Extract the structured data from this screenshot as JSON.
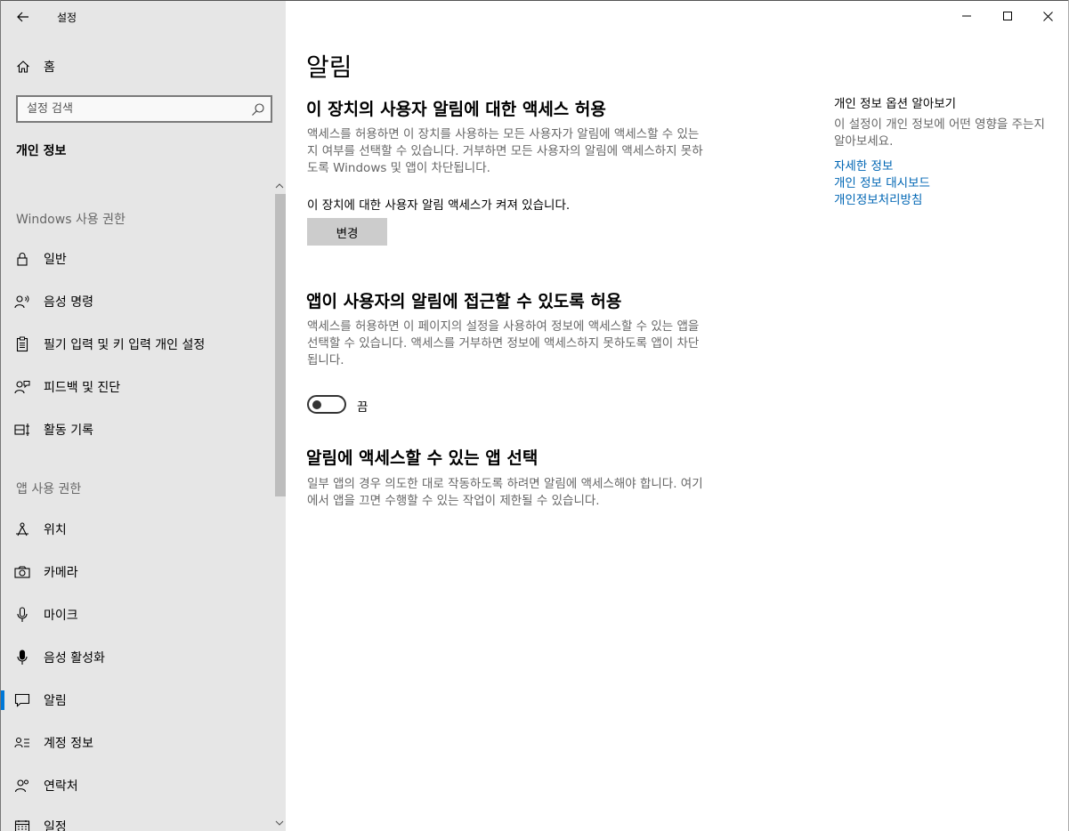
{
  "window": {
    "title": "설정",
    "controls": {
      "minimize": "minimize",
      "maximize": "maximize",
      "close": "close"
    }
  },
  "sidebar": {
    "home_label": "홈",
    "search_placeholder": "설정 검색",
    "section_title": "개인 정보",
    "groups": [
      {
        "label": "Windows 사용 권한",
        "items": [
          {
            "label": "일반",
            "icon": "lock-icon"
          },
          {
            "label": "음성 명령",
            "icon": "speech-icon"
          },
          {
            "label": "필기 입력 및 키 입력 개인 설정",
            "icon": "clipboard-icon"
          },
          {
            "label": "피드백 및 진단",
            "icon": "feedback-icon"
          },
          {
            "label": "활동 기록",
            "icon": "timeline-icon"
          }
        ]
      },
      {
        "label": "앱 사용 권한",
        "items": [
          {
            "label": "위치",
            "icon": "location-icon"
          },
          {
            "label": "카메라",
            "icon": "camera-icon"
          },
          {
            "label": "마이크",
            "icon": "microphone-icon"
          },
          {
            "label": "음성 활성화",
            "icon": "voice-activation-icon"
          },
          {
            "label": "알림",
            "icon": "notification-icon",
            "active": true
          },
          {
            "label": "계정 정보",
            "icon": "account-info-icon"
          },
          {
            "label": "연락처",
            "icon": "contacts-icon"
          },
          {
            "label": "일정",
            "icon": "calendar-icon"
          }
        ]
      }
    ]
  },
  "main": {
    "page_title": "알림",
    "section1": {
      "heading": "이 장치의 사용자 알림에 대한 액세스 허용",
      "desc": "액세스를 허용하면 이 장치를 사용하는 모든 사용자가 알림에 액세스할 수 있는지 여부를 선택할 수 있습니다. 거부하면 모든 사용자의 알림에 액세스하지 못하도록 Windows 및 앱이 차단됩니다.",
      "status": "이 장치에 대한 사용자 알림 액세스가 켜져 있습니다.",
      "button": "변경"
    },
    "section2": {
      "heading": "앱이 사용자의 알림에 접근할 수 있도록 허용",
      "desc": "액세스를 허용하면 이 페이지의 설정을 사용하여 정보에 액세스할 수 있는 앱을 선택할 수 있습니다. 액세스를 거부하면 정보에 액세스하지 못하도록 앱이 차단됩니다.",
      "toggle_state": "끔",
      "toggle_on": false
    },
    "section3": {
      "heading": "알림에 액세스할 수 있는 앱 선택",
      "desc": "일부 앱의 경우 의도한 대로 작동하도록 하려면 알림에 액세스해야 합니다. 여기에서 앱을 끄면 수행할 수 있는 작업이 제한될 수 있습니다."
    }
  },
  "right_panel": {
    "title": "개인 정보 옵션 알아보기",
    "desc": "이 설정이 개인 정보에 어떤 영향을 주는지 알아보세요.",
    "links": [
      "자세한 정보",
      "개인 정보 대시보드",
      "개인정보처리방침"
    ]
  },
  "colors": {
    "accent": "#0078d7",
    "link": "#0066b4",
    "sidebar_bg": "#e6e6e6",
    "button_bg": "#cccccc"
  }
}
